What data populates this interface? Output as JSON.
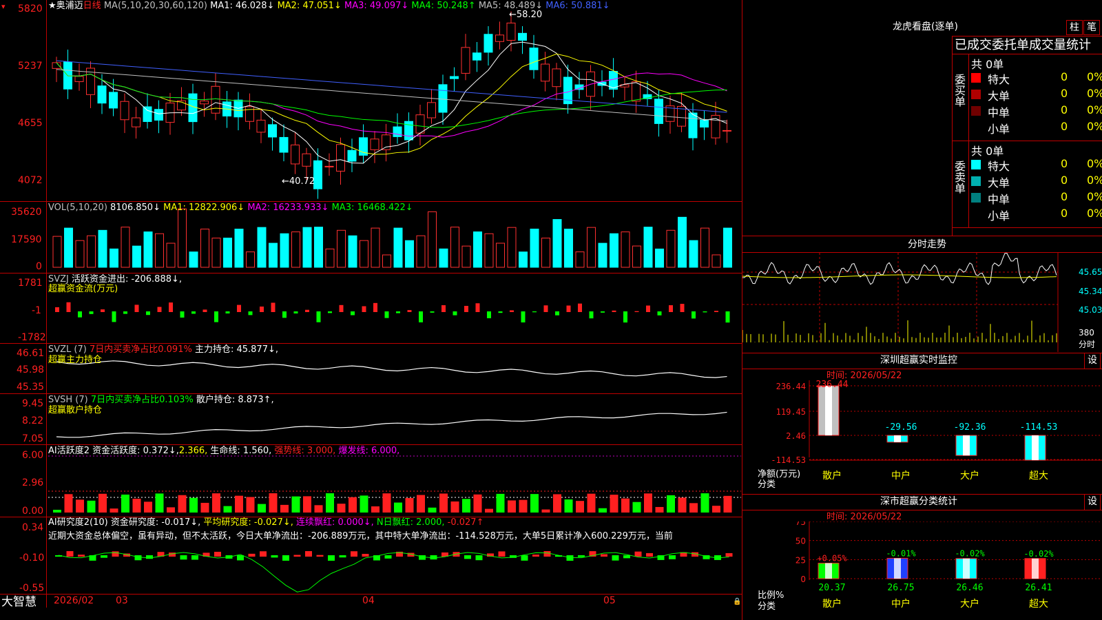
{
  "stock": {
    "name": "奥浦迈",
    "period": "日线"
  },
  "kline": {
    "ma_label": "MA(5,10,20,30,60,120)",
    "ma": [
      {
        "name": "MA1:",
        "value": "46.028↓",
        "color": "#ffffff"
      },
      {
        "name": "MA2:",
        "value": "47.051↓",
        "color": "#ffff00"
      },
      {
        "name": "MA3:",
        "value": "49.097↓",
        "color": "#ff00ff"
      },
      {
        "name": "MA4:",
        "value": "50.248↑",
        "color": "#00ff00"
      },
      {
        "name": "MA5:",
        "value": "48.489↓",
        "color": "#c0c0c0"
      },
      {
        "name": "MA6:",
        "value": "50.881↓",
        "color": "#4060ff"
      }
    ],
    "y_ticks": [
      "5820",
      "5237",
      "4655",
      "4072"
    ],
    "high_label": "58.20",
    "low_label": "40.72"
  },
  "vol": {
    "label": "VOL(5,10,20)",
    "value": "8106.850↓",
    "ma1": "MA1: 12822.906↓",
    "ma2": "MA2: 16233.933↓",
    "ma3": "MA3: 16468.422↓",
    "y_ticks": [
      "35620",
      "17590",
      "0"
    ]
  },
  "svzj": {
    "label": "SVZJ",
    "text": "活跃资金进出: -206.888↓,",
    "sub": "超赢资金流(万元)",
    "y_ticks": [
      "1781",
      "-1",
      "-1782"
    ]
  },
  "svzl": {
    "label": "SVZL (7)",
    "pct": "7日内买卖净占比0.091%",
    "hold": "主力持仓: 45.877↓,",
    "sub": "超赢主力持仓",
    "y_ticks": [
      "46.61",
      "45.98",
      "45.35"
    ]
  },
  "svsh": {
    "label": "SVSH (7)",
    "pct": "7日内买卖净占比0.103%",
    "hold": "散户持仓: 8.873↑,",
    "sub": "超赢散户持仓",
    "y_ticks": [
      "9.45",
      "8.22",
      "7.05"
    ]
  },
  "ai1": {
    "label": "AI活跃度2",
    "t1": "资金活跃度: 0.372↓,",
    "t2": "2.366,",
    "t3": "生命线: 1.560,",
    "t4": "强势线: 3.000,",
    "t5": "爆发线: 6.000,",
    "y_ticks": [
      "6.00",
      "2.96",
      "0.00"
    ]
  },
  "ai2": {
    "label": "AI研究度2(10)",
    "t1": "资金研究度: -0.017↓,",
    "t2": "平均研究度: -0.027↓,",
    "t3": "连续飘红: 0.000↓,",
    "t4": "N日飘红: 2.000,",
    "t5": "-0.027↑",
    "summary": "近期大资金总体偏空，虽有异动，但不太活跃，今日大单净流出：-206.889万元，其中特大单净流出：-114.528万元，大单5日累计净入600.229万元，当前",
    "y_ticks": [
      "0.34",
      "-0.10",
      "-0.55"
    ]
  },
  "xaxis": {
    "start": "2026/02",
    "m3": "03",
    "m4": "04",
    "m5": "05"
  },
  "brand": "大智慧",
  "right": {
    "dragon_title": "龙虎看盘(逐单)",
    "btn_bar": "柱",
    "btn_tick": "笔",
    "stat_header": "已成交委托单成交量统计",
    "buy_label": "委买单",
    "sell_label": "委卖单",
    "buy_total": "共 0单",
    "sell_total": "共 0单",
    "buy_rows": [
      {
        "name": "特大",
        "count": "0",
        "pct": "0%",
        "color": "#ff0000"
      },
      {
        "name": "大单",
        "count": "0",
        "pct": "0%",
        "color": "#b00000"
      },
      {
        "name": "中单",
        "count": "0",
        "pct": "0%",
        "color": "#700000"
      },
      {
        "name": "小单",
        "count": "0",
        "pct": "0%",
        "color": "#000000"
      }
    ],
    "sell_rows": [
      {
        "name": "特大",
        "count": "0",
        "pct": "0%",
        "color": "#00ffff"
      },
      {
        "name": "大单",
        "count": "0",
        "pct": "0%",
        "color": "#00b0b0"
      },
      {
        "name": "中单",
        "count": "0",
        "pct": "0%",
        "color": "#008080"
      },
      {
        "name": "小单",
        "count": "0",
        "pct": "0%",
        "color": "#000000"
      }
    ],
    "intraday_title": "分时走势",
    "intraday_y": [
      "45.65",
      "45.34",
      "45.03",
      "380"
    ],
    "intraday_unit": "分时",
    "sz_title": "深圳超赢实时监控",
    "sz_btn": "设",
    "sz_time": "时间: 2026/05/22",
    "sz_y": [
      "236.44",
      "119.45",
      "2.46",
      "-114.53"
    ],
    "sz_ylabel": "净额(万元)",
    "sz_xlabel": "分类",
    "sz_bars": [
      {
        "cat": "散户",
        "value": 236.44,
        "label": "236.44"
      },
      {
        "cat": "中户",
        "value": -29.56,
        "label": "-29.56"
      },
      {
        "cat": "大户",
        "value": -92.36,
        "label": "-92.36"
      },
      {
        "cat": "超大",
        "value": -114.53,
        "label": "-114.53"
      }
    ],
    "cls_title": "深市超赢分类统计",
    "cls_btn": "设",
    "cls_time": "时间: 2026/05/22",
    "cls_y": [
      "75",
      "50",
      "25",
      "0"
    ],
    "cls_ylabel": "比例%",
    "cls_xlabel": "分类",
    "cls_bars": [
      {
        "cat": "散户",
        "value": 20.37,
        "label": "20.37",
        "chg": "+0.05%",
        "color": "#00ff00"
      },
      {
        "cat": "中户",
        "value": 26.75,
        "label": "26.75",
        "chg": "-0.01%",
        "color": "#2040ff"
      },
      {
        "cat": "大户",
        "value": 26.46,
        "label": "26.46",
        "chg": "-0.02%",
        "color": "#00ffff"
      },
      {
        "cat": "超大",
        "value": 26.41,
        "label": "26.41",
        "chg": "-0.02%",
        "color": "#ff2020"
      }
    ]
  }
}
